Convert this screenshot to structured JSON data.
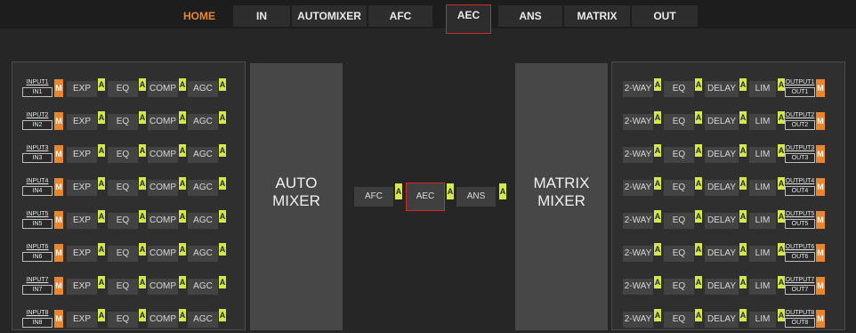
{
  "nav": {
    "tabs": [
      {
        "label": "HOME"
      },
      {
        "label": "IN"
      },
      {
        "label": "AUTOMIXER"
      },
      {
        "label": "AFC"
      },
      {
        "label": "AEC"
      },
      {
        "label": "ANS"
      },
      {
        "label": "MATRIX"
      },
      {
        "label": "OUT"
      }
    ]
  },
  "inputs": [
    {
      "top": "INPUT1",
      "name": "IN1"
    },
    {
      "top": "INPUT2",
      "name": "IN2"
    },
    {
      "top": "INPUT3",
      "name": "IN3"
    },
    {
      "top": "INPUT4",
      "name": "IN4"
    },
    {
      "top": "INPUT5",
      "name": "IN5"
    },
    {
      "top": "INPUT6",
      "name": "IN6"
    },
    {
      "top": "INPUT7",
      "name": "IN7"
    },
    {
      "top": "INPUT8",
      "name": "IN8"
    }
  ],
  "input_chain": {
    "m": "M",
    "exp": "EXP",
    "eq": "EQ",
    "comp": "COMP",
    "agc": "AGC",
    "a": "A"
  },
  "outputs": [
    {
      "top": "OUTPUT1",
      "name": "OUT1"
    },
    {
      "top": "OUTPUT2",
      "name": "OUT2"
    },
    {
      "top": "OUTPUT3",
      "name": "OUT3"
    },
    {
      "top": "OUTPUT4",
      "name": "OUT4"
    },
    {
      "top": "OUTPUT5",
      "name": "OUT5"
    },
    {
      "top": "OUTPUT6",
      "name": "OUT6"
    },
    {
      "top": "OUTPUT7",
      "name": "OUT7"
    },
    {
      "top": "OUTPUT8",
      "name": "OUT8"
    }
  ],
  "output_chain": {
    "twoway": "2-WAY",
    "eq": "EQ",
    "delay": "DELAY",
    "lim": "LIM",
    "a": "A",
    "m": "M"
  },
  "automixer": {
    "line1": "AUTO",
    "line2": "MIXER"
  },
  "matrix": {
    "line1": "MATRIX",
    "line2": "MIXER"
  },
  "mid_chain": {
    "afc": "AFC",
    "aec": "AEC",
    "ans": "ANS",
    "a": "A"
  },
  "colors": {
    "accent": "#e8862e",
    "indicator": "#d4e84c",
    "selected_border": "#d12a2a"
  }
}
